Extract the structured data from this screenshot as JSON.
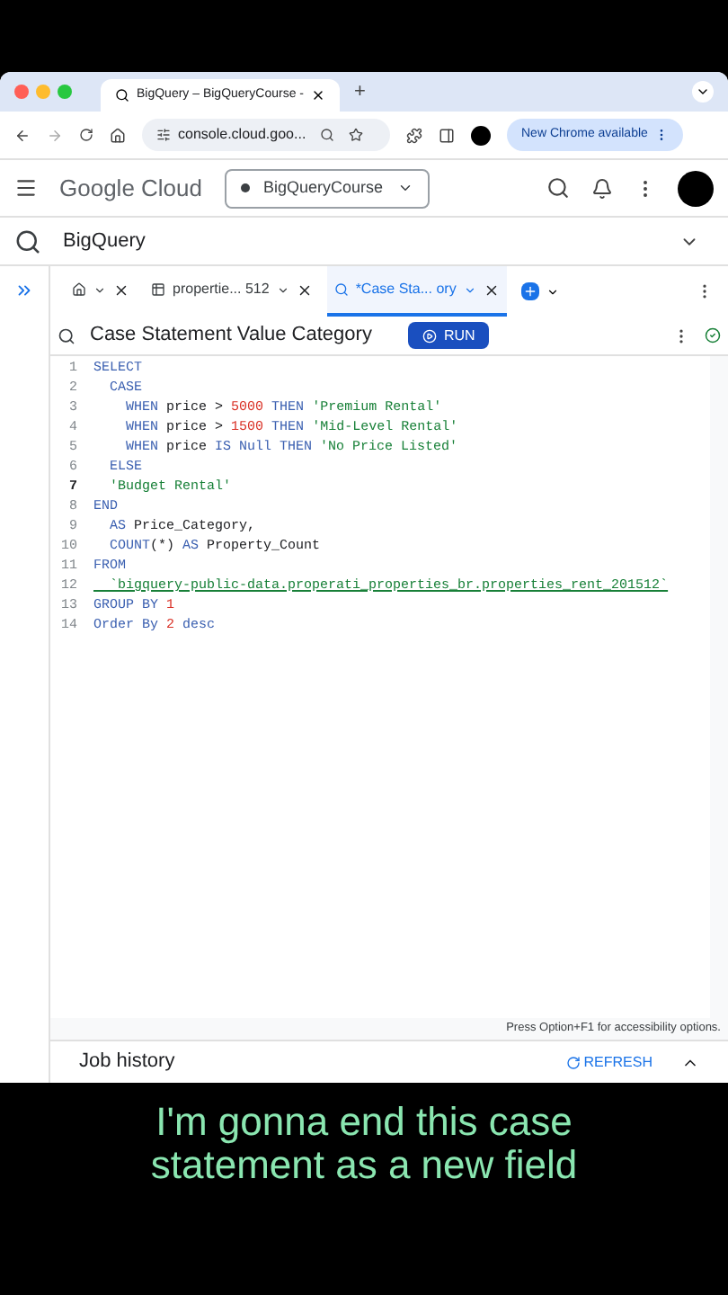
{
  "browser": {
    "tab_title": "BigQuery – BigQueryCourse -",
    "new_tab": "+",
    "url": "console.cloud.goo...",
    "update_button": "New Chrome available"
  },
  "header": {
    "product": "Google Cloud",
    "project": "BigQueryCourse"
  },
  "section": {
    "title": "BigQuery"
  },
  "editor_tabs": [
    {
      "kind": "home",
      "selected": false
    },
    {
      "kind": "table",
      "label": "propertie... 512",
      "selected": false
    },
    {
      "kind": "query",
      "label": "*Case Sta... ory",
      "selected": true
    }
  ],
  "query": {
    "title": "Case Statement Value Category",
    "run_button": "RUN"
  },
  "code_lines": [
    {
      "number": "1",
      "current": false,
      "tokens": [
        {
          "kind": "keyword",
          "text": "SELECT"
        }
      ]
    },
    {
      "number": "2",
      "current": false,
      "tokens": [
        {
          "kind": "keyword",
          "text": "  CASE"
        }
      ]
    },
    {
      "number": "3",
      "current": false,
      "tokens": [
        {
          "kind": "keyword",
          "text": "    WHEN"
        },
        {
          "kind": "identifier",
          "text": " price > "
        },
        {
          "kind": "number",
          "text": "5000"
        },
        {
          "kind": "keyword",
          "text": " THEN "
        },
        {
          "kind": "string",
          "text": "'Premium Rental'"
        }
      ]
    },
    {
      "number": "4",
      "current": false,
      "tokens": [
        {
          "kind": "keyword",
          "text": "    WHEN"
        },
        {
          "kind": "identifier",
          "text": " price > "
        },
        {
          "kind": "number",
          "text": "1500"
        },
        {
          "kind": "keyword",
          "text": " THEN "
        },
        {
          "kind": "string",
          "text": "'Mid-Level Rental'"
        }
      ]
    },
    {
      "number": "5",
      "current": false,
      "tokens": [
        {
          "kind": "keyword",
          "text": "    WHEN"
        },
        {
          "kind": "identifier",
          "text": " price "
        },
        {
          "kind": "keyword",
          "text": "IS Null THEN "
        },
        {
          "kind": "string",
          "text": "'No Price Listed'"
        }
      ]
    },
    {
      "number": "6",
      "current": false,
      "tokens": [
        {
          "kind": "keyword",
          "text": "  ELSE"
        }
      ]
    },
    {
      "number": "7",
      "current": true,
      "tokens": [
        {
          "kind": "string",
          "text": "  'Budget Rental'"
        }
      ]
    },
    {
      "number": "8",
      "current": false,
      "tokens": [
        {
          "kind": "keyword",
          "text": "END"
        }
      ]
    },
    {
      "number": "9",
      "current": false,
      "tokens": [
        {
          "kind": "keyword",
          "text": "  AS"
        },
        {
          "kind": "identifier",
          "text": " Price_Category,"
        }
      ]
    },
    {
      "number": "10",
      "current": false,
      "tokens": [
        {
          "kind": "keyword",
          "text": "  COUNT"
        },
        {
          "kind": "identifier",
          "text": "(*) "
        },
        {
          "kind": "keyword",
          "text": "AS"
        },
        {
          "kind": "identifier",
          "text": " Property_Count"
        }
      ]
    },
    {
      "number": "11",
      "current": false,
      "tokens": [
        {
          "kind": "keyword",
          "text": "FROM"
        }
      ]
    },
    {
      "number": "12",
      "current": false,
      "tokens": [
        {
          "kind": "table",
          "text": "  `bigquery-public-data.properati_properties_br.properties_rent_201512`"
        }
      ]
    },
    {
      "number": "13",
      "current": false,
      "tokens": [
        {
          "kind": "keyword",
          "text": "GROUP BY "
        },
        {
          "kind": "number",
          "text": "1"
        }
      ]
    },
    {
      "number": "14",
      "current": false,
      "tokens": [
        {
          "kind": "keyword",
          "text": "Order By "
        },
        {
          "kind": "number",
          "text": "2"
        },
        {
          "kind": "keyword",
          "text": " desc"
        }
      ]
    }
  ],
  "accessibility_hint": "Press Option+F1 for accessibility options.",
  "job_history": {
    "title": "Job history",
    "refresh_button": "REFRESH"
  },
  "caption": "I'm gonna end this case statement as a new field"
}
